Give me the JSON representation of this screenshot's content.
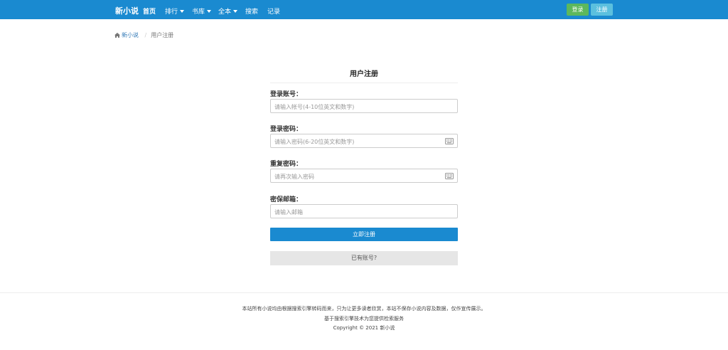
{
  "navbar": {
    "brand": "新小说",
    "items": [
      {
        "label": "首页",
        "dropdown": false
      },
      {
        "label": "排行",
        "dropdown": true
      },
      {
        "label": "书库",
        "dropdown": true
      },
      {
        "label": "全本",
        "dropdown": true
      },
      {
        "label": "搜索",
        "dropdown": false
      },
      {
        "label": "记录",
        "dropdown": false
      }
    ],
    "login": "登录",
    "register": "注册"
  },
  "breadcrumb": {
    "home": "新小说",
    "current": "用户注册"
  },
  "form": {
    "title": "用户注册",
    "fields": [
      {
        "label": "登录账号：",
        "placeholder": "请输入帐号(4-10位英文和数字)"
      },
      {
        "label": "登录密码：",
        "placeholder": "请输入密码(6-20位英文和数字)"
      },
      {
        "label": "重复密码：",
        "placeholder": "请再次输入密码"
      },
      {
        "label": "密保邮箱：",
        "placeholder": "请输入邮箱"
      }
    ],
    "submit": "立即注册",
    "has_account": "已有账号?"
  },
  "footer": {
    "line1": "本站所有小说均由根据搜索引擎转码而来，只为让更多读者欣赏，本站不保存小说内容及数据，仅作宣传展示。",
    "line2": "基于搜索引擎技术为您提供检索服务",
    "copyright": "Copyright © 2021 新小说"
  },
  "colors": {
    "primary": "#1a8ad0",
    "login": "#5cb85c",
    "register": "#5bc0de"
  },
  "icons": {
    "home": "home-icon",
    "keyboard": "keyboard-icon",
    "caret": "caret-down-icon"
  }
}
